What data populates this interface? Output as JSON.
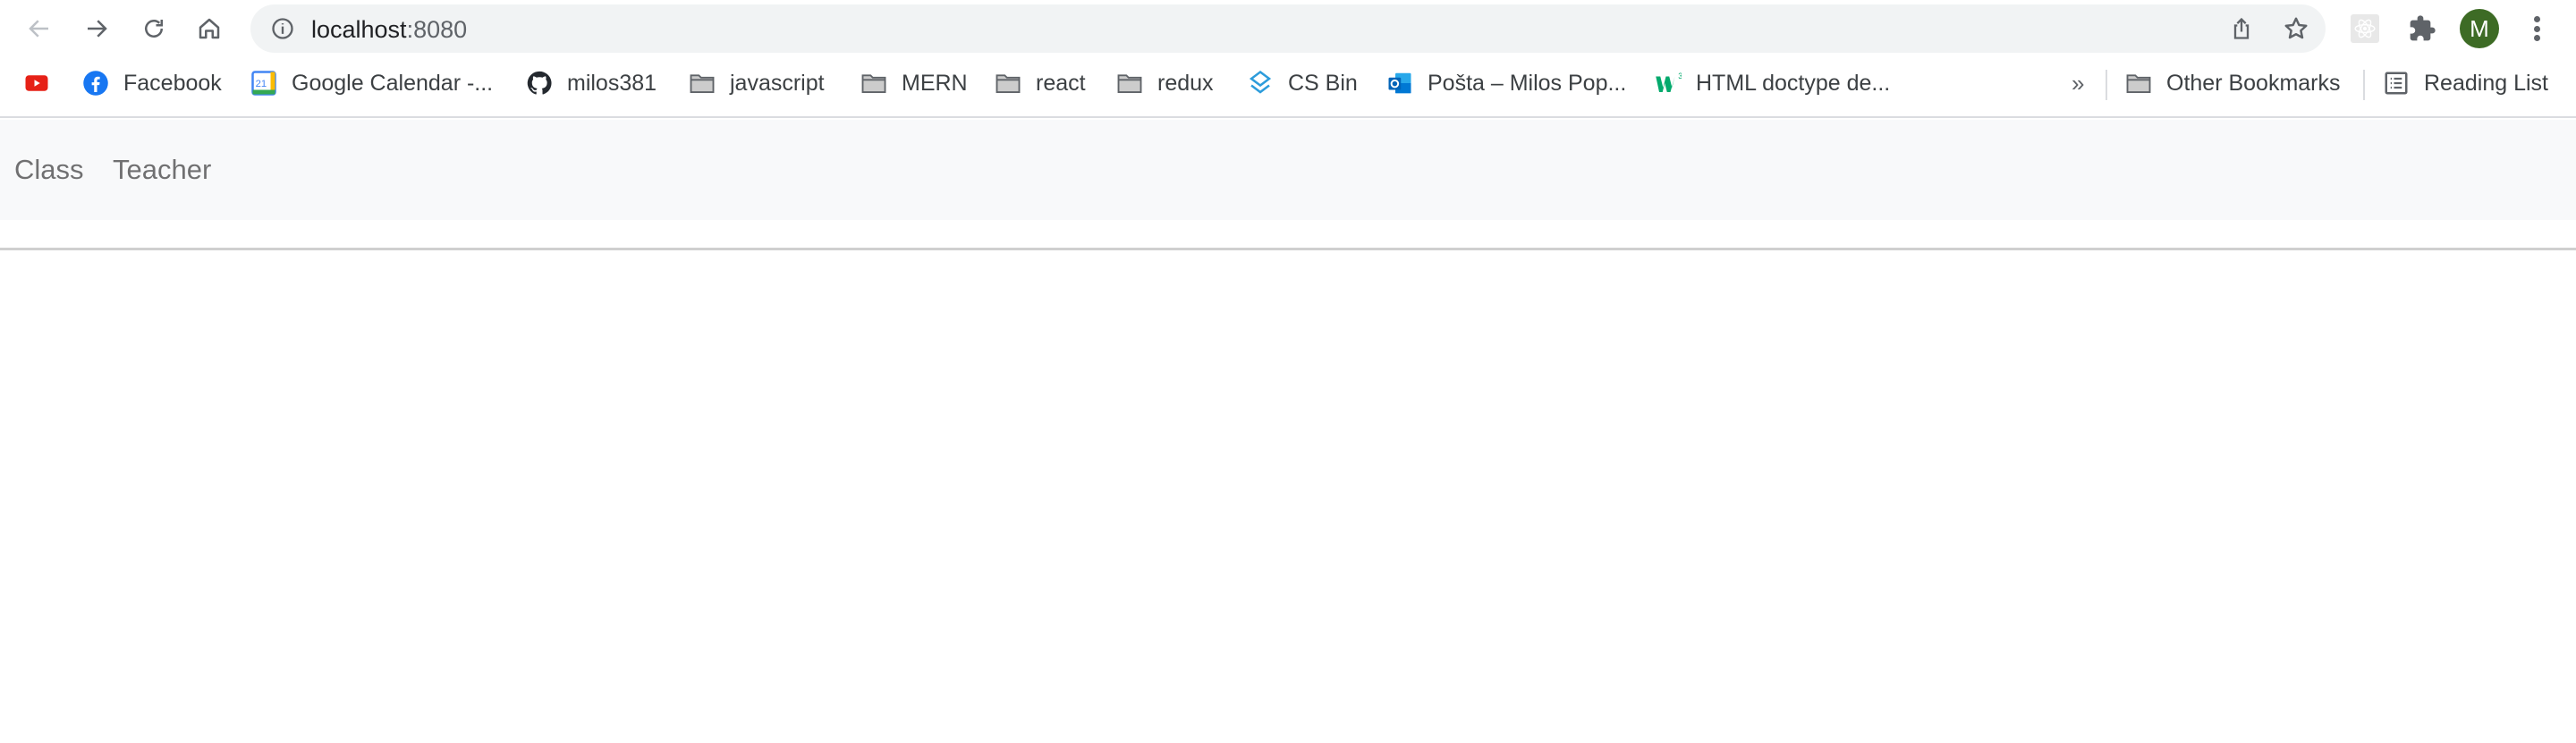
{
  "browser": {
    "toolbar": {
      "back_icon": "arrow-left-icon",
      "forward_icon": "arrow-right-icon",
      "reload_icon": "reload-icon",
      "home_icon": "home-icon",
      "address_bar": {
        "host": "localhost",
        "port": ":8080",
        "site_info_icon": "info-icon",
        "share_icon": "share-icon",
        "bookmark_icon": "star-icon"
      },
      "extensions": {
        "react_devtools_icon": "react-icon",
        "extensions_icon": "puzzle-icon"
      },
      "profile": {
        "initial": "M",
        "color": "#3d6b25"
      },
      "menu_icon": "kebab-menu-icon"
    },
    "bookmarks": [
      {
        "label": "",
        "icon": "youtube-icon"
      },
      {
        "label": "Facebook",
        "icon": "facebook-icon"
      },
      {
        "label": "Google Calendar -...",
        "icon": "google-calendar-icon",
        "icon_text": "21"
      },
      {
        "label": "milos381",
        "icon": "github-icon"
      },
      {
        "label": "javascript",
        "icon": "folder-icon"
      },
      {
        "label": "MERN",
        "icon": "folder-icon"
      },
      {
        "label": "react",
        "icon": "folder-icon"
      },
      {
        "label": "redux",
        "icon": "folder-icon"
      },
      {
        "label": "CS Bin",
        "icon": "csbin-icon"
      },
      {
        "label": "Pošta – Milos Pop...",
        "icon": "outlook-icon"
      },
      {
        "label": "HTML doctype de...",
        "icon": "w3schools-icon"
      }
    ],
    "overflow_chevron": "»",
    "other_bookmarks": {
      "label": "Other Bookmarks",
      "icon": "folder-icon"
    },
    "reading_list": {
      "label": "Reading List",
      "icon": "reading-list-icon"
    }
  },
  "page": {
    "navbar": {
      "links": [
        {
          "label": "Class"
        },
        {
          "label": "Teacher"
        }
      ],
      "background": "#f8f9fa"
    }
  }
}
